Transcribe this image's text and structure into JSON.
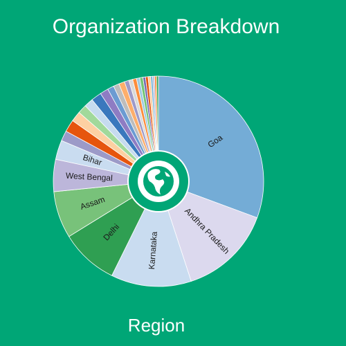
{
  "page": {
    "title": "Organization Breakdown",
    "category_label": "Region",
    "background": "#00a676",
    "center_icon": "globe-americas-icon"
  },
  "chart_data": {
    "type": "pie",
    "variant": "donut-with-center-icon",
    "title": "Organization Breakdown",
    "xlabel": "Region",
    "slices": [
      {
        "label": "Goa",
        "value": 31.0,
        "color": "#74acd6",
        "show_label": true
      },
      {
        "label": "Andhra Pradesh",
        "value": 14.5,
        "color": "#dcd9ee",
        "show_label": true
      },
      {
        "label": "Karnataka",
        "value": 12.5,
        "color": "#c9dcf0",
        "show_label": true
      },
      {
        "label": "Delhi",
        "value": 9.0,
        "color": "#2f9f52",
        "show_label": true
      },
      {
        "label": "Assam",
        "value": 7.3,
        "color": "#78c27a",
        "show_label": true
      },
      {
        "label": "West Bengal",
        "value": 5.0,
        "color": "#bcb6da",
        "show_label": true
      },
      {
        "label": "Bihar",
        "value": 3.0,
        "color": "#c9dcf0",
        "show_label": true
      },
      {
        "label": "",
        "value": 1.6,
        "color": "#9c9ac8",
        "show_label": false
      },
      {
        "label": "",
        "value": 1.9,
        "color": "#e6550d",
        "show_label": false
      },
      {
        "label": "",
        "value": 1.6,
        "color": "#fdd0a2",
        "show_label": false
      },
      {
        "label": "",
        "value": 1.4,
        "color": "#a1d99b",
        "show_label": false
      },
      {
        "label": "",
        "value": 1.4,
        "color": "#c6dbef",
        "show_label": false
      },
      {
        "label": "",
        "value": 1.6,
        "color": "#3a78bd",
        "show_label": false
      },
      {
        "label": "",
        "value": 1.3,
        "color": "#8e7cc3",
        "show_label": false
      },
      {
        "label": "",
        "value": 1.0,
        "color": "#6b9bd2",
        "show_label": false
      },
      {
        "label": "",
        "value": 0.9,
        "color": "#bdbdbd",
        "show_label": false
      },
      {
        "label": "",
        "value": 0.9,
        "color": "#fdae6b",
        "show_label": false
      },
      {
        "label": "",
        "value": 0.7,
        "color": "#9e9ac8",
        "show_label": false
      },
      {
        "label": "",
        "value": 0.6,
        "color": "#d9d9d9",
        "show_label": false
      },
      {
        "label": "",
        "value": 0.6,
        "color": "#fd8d3c",
        "show_label": false
      },
      {
        "label": "",
        "value": 0.5,
        "color": "#9ecae1",
        "show_label": false
      },
      {
        "label": "",
        "value": 0.5,
        "color": "#74c476",
        "show_label": false
      },
      {
        "label": "",
        "value": 0.4,
        "color": "#756bb1",
        "show_label": false
      },
      {
        "label": "",
        "value": 0.4,
        "color": "#e6550d",
        "show_label": false
      },
      {
        "label": "",
        "value": 0.4,
        "color": "#fdd0a2",
        "show_label": false
      },
      {
        "label": "",
        "value": 0.3,
        "color": "#6baed6",
        "show_label": false
      },
      {
        "label": "",
        "value": 0.3,
        "color": "#bcbddc",
        "show_label": false
      },
      {
        "label": "",
        "value": 0.3,
        "color": "#fd8d3c",
        "show_label": false
      },
      {
        "label": "",
        "value": 0.3,
        "color": "#31a354",
        "show_label": false
      }
    ]
  }
}
